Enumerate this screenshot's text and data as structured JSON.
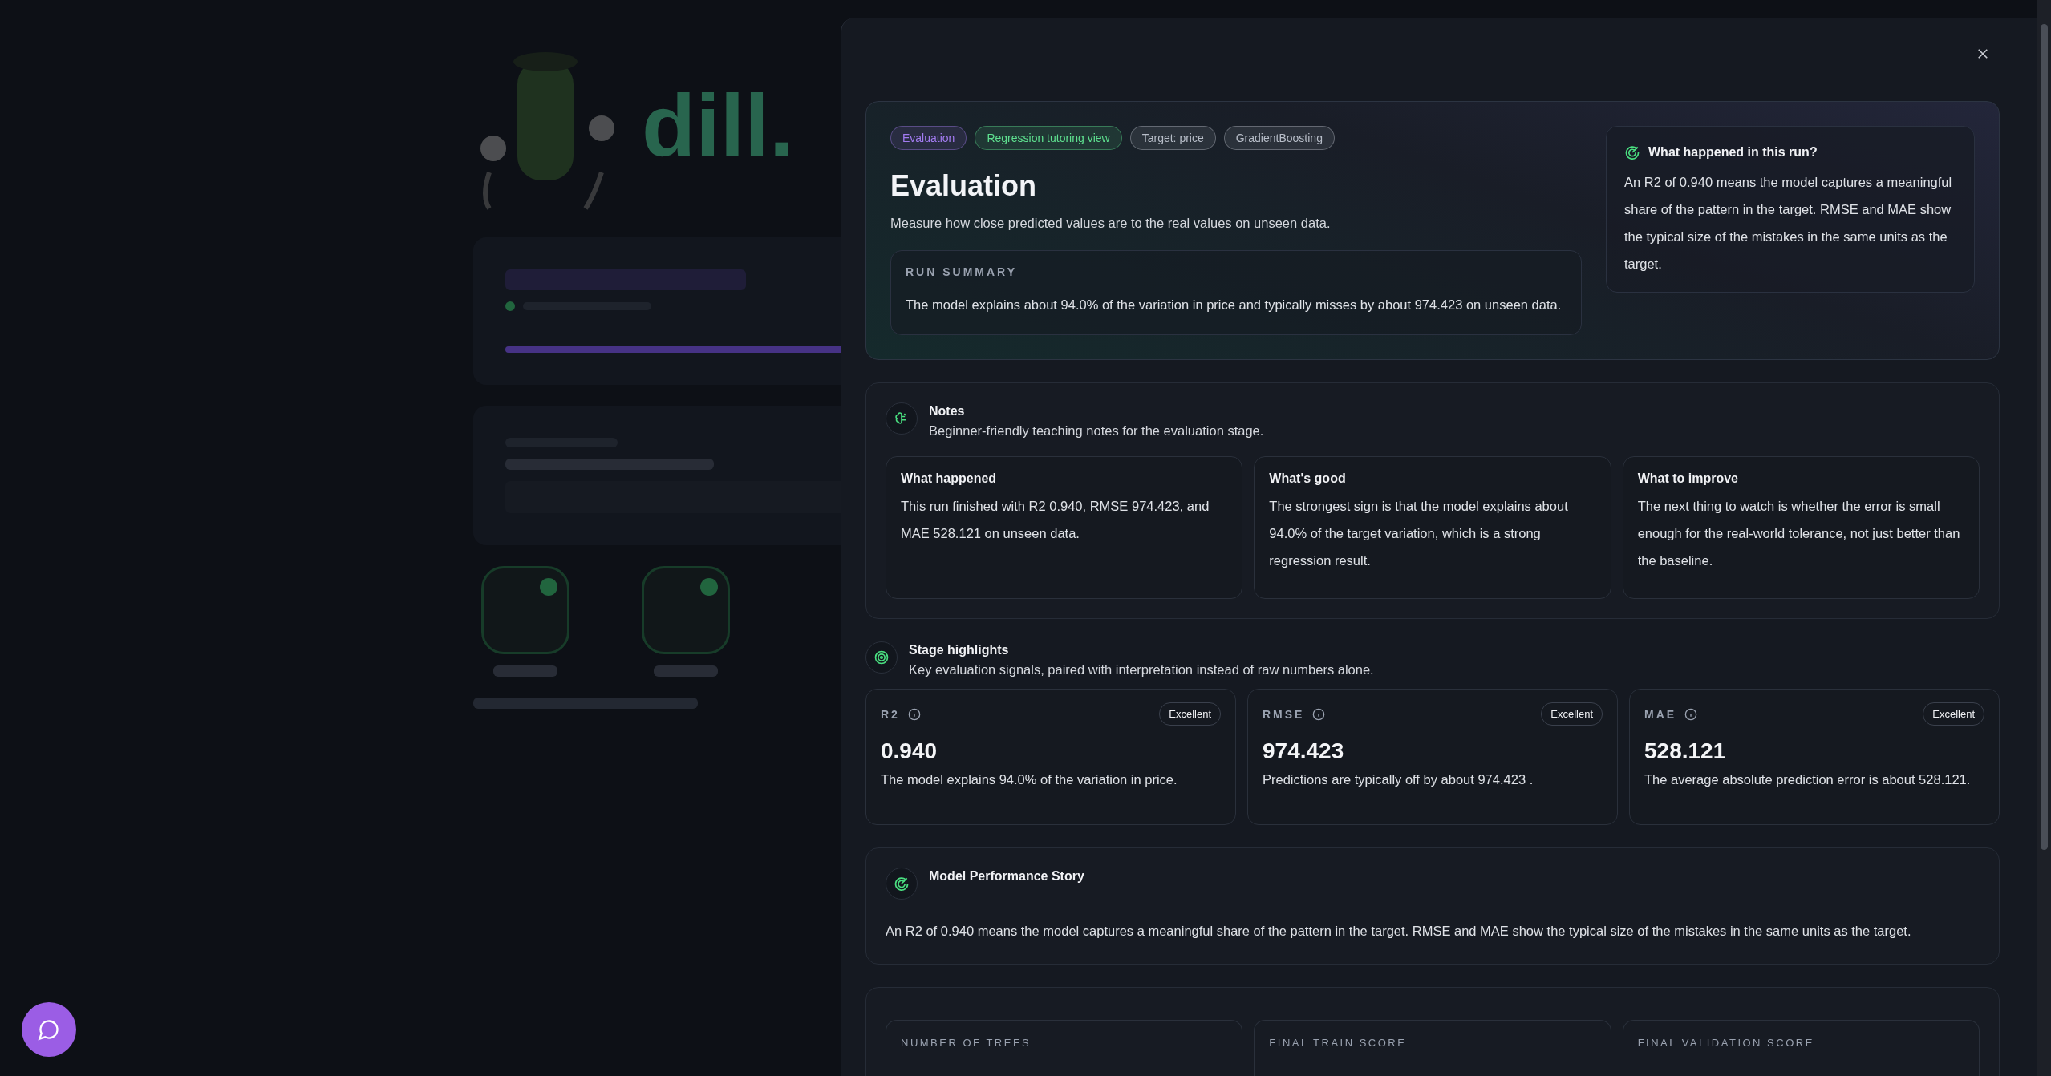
{
  "background": {
    "logo": "dill.",
    "progress": {
      "level": 1
    },
    "pipeline": [
      {
        "done": true
      },
      {
        "done": true
      }
    ]
  },
  "drawer": {
    "tags": [
      {
        "label": "Evaluation",
        "color": "#a27bf0"
      },
      {
        "label": "Regression tutoring view",
        "color": "#5ee08f"
      },
      {
        "label": "Target: price",
        "color": "#b8bec9"
      },
      {
        "label": "GradientBoosting",
        "color": "#b8bec9"
      }
    ],
    "title": "Evaluation",
    "subtitle": "Measure how close predicted values are to the real values on unseen data.",
    "run_summary": {
      "label": "RUN SUMMARY",
      "text": "The model explains about 94.0% of the variation in price and typically misses by about 974.423 on unseen data."
    },
    "side_note": {
      "title": "What happened in this run?",
      "text": "An R2 of 0.940 means the model captures a meaningful share of the pattern in the target. RMSE and MAE show the typical size of the mistakes in the same units as the target."
    },
    "notes": {
      "title": "Notes",
      "subtitle": "Beginner-friendly teaching notes for the evaluation stage.",
      "cards": [
        {
          "title": "What happened",
          "text": "This run finished with R2 0.940, RMSE 974.423, and MAE 528.121 on unseen data."
        },
        {
          "title": "What's good",
          "text": "The strongest sign is that the model explains about 94.0% of the target variation, which is a strong regression result."
        },
        {
          "title": "What to improve",
          "text": "The next thing to watch is whether the error is small enough for the real-world tolerance, not just better than the baseline."
        }
      ]
    },
    "highlights": {
      "title": "Stage highlights",
      "subtitle": "Key evaluation signals, paired with interpretation instead of raw numbers alone.",
      "metrics": [
        {
          "name": "R2",
          "badge": "Excellent",
          "value": "0.940",
          "text": "The model explains 94.0% of the variation in price."
        },
        {
          "name": "RMSE",
          "badge": "Excellent",
          "value": "974.423",
          "text": "Predictions are typically off by about 974.423 ."
        },
        {
          "name": "MAE",
          "badge": "Excellent",
          "value": "528.121",
          "text": "The average absolute prediction error is about 528.121."
        }
      ]
    },
    "story": {
      "title": "Model Performance Story",
      "text": "An R2 of 0.940 means the model captures a meaningful share of the pattern in the target. RMSE and MAE show the typical size of the mistakes in the same units as the target."
    },
    "details": [
      {
        "label": "NUMBER OF TREES"
      },
      {
        "label": "FINAL TRAIN SCORE"
      },
      {
        "label": "FINAL VALIDATION SCORE"
      }
    ]
  }
}
